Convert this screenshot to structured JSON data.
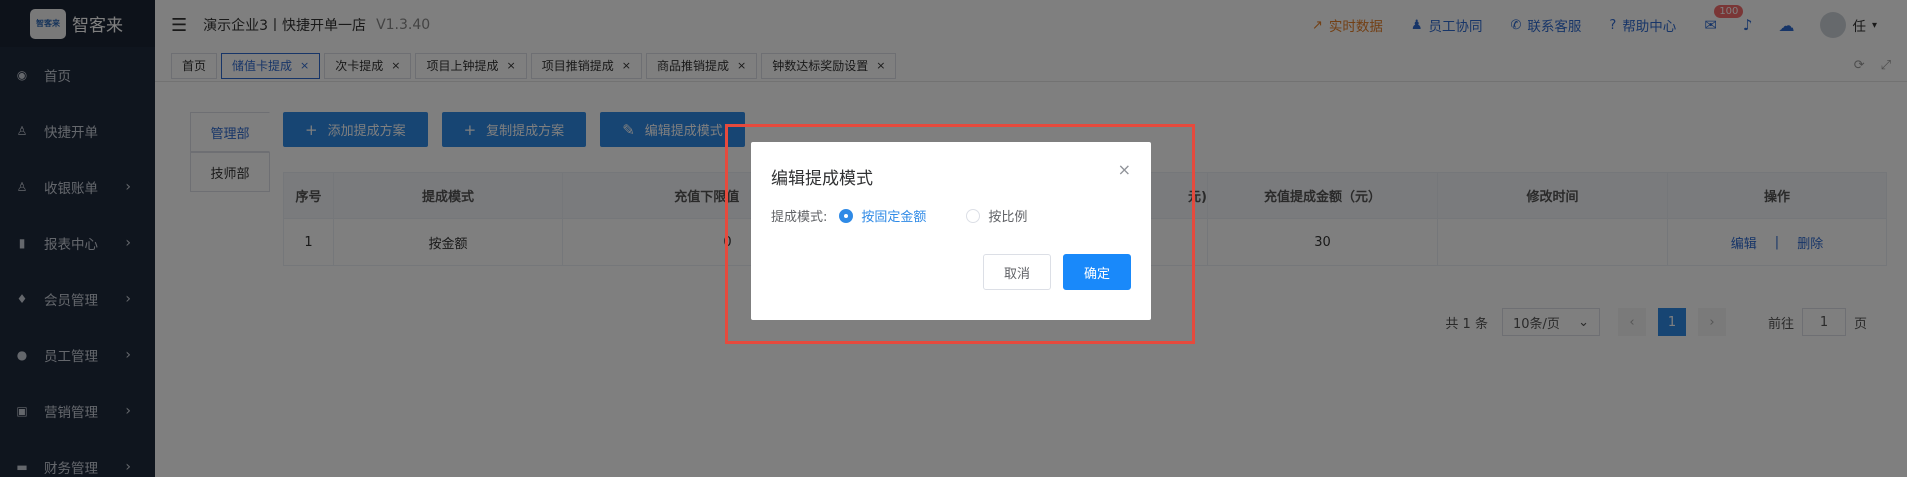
{
  "sidebar": {
    "logo_text": "智客来",
    "logo_mark": "智客来",
    "items": [
      {
        "label": "首页",
        "icon": "◉",
        "arrow": ""
      },
      {
        "label": "快捷开单",
        "icon": "♙",
        "arrow": ""
      },
      {
        "label": "收银账单",
        "icon": "♙",
        "arrow": "›"
      },
      {
        "label": "报表中心",
        "icon": "▮",
        "arrow": "›"
      },
      {
        "label": "会员管理",
        "icon": "♦",
        "arrow": "›"
      },
      {
        "label": "员工管理",
        "icon": "●",
        "arrow": "›"
      },
      {
        "label": "营销管理",
        "icon": "▣",
        "arrow": "›"
      },
      {
        "label": "财务管理",
        "icon": "▬",
        "arrow": "›"
      }
    ]
  },
  "header": {
    "menu_icon": "☰",
    "store_title": "演示企业3丨快捷开单一店",
    "version": "V1.3.40",
    "links": {
      "realtime": "实时数据",
      "staff_collab": "员工协同",
      "support": "联系客服",
      "help": "帮助中心"
    },
    "mail_badge": "100",
    "user_name": "任",
    "user_caret": "▾"
  },
  "tabs": [
    {
      "label": "首页",
      "closable": false
    },
    {
      "label": "储值卡提成",
      "closable": true
    },
    {
      "label": "次卡提成",
      "closable": true
    },
    {
      "label": "项目上钟提成",
      "closable": true
    },
    {
      "label": "项目推销提成",
      "closable": true
    },
    {
      "label": "商品推销提成",
      "closable": true
    },
    {
      "label": "钟数达标奖励设置",
      "closable": true
    }
  ],
  "depts": [
    "管理部",
    "技师部"
  ],
  "actions": {
    "add": "添加提成方案",
    "copy": "复制提成方案",
    "edit": "编辑提成模式"
  },
  "table": {
    "headers": [
      "序号",
      "提成模式",
      "充值下限值 （>）",
      "元)",
      "充值提成金额（元）",
      "修改时间",
      "操作"
    ],
    "rows": [
      {
        "index": "1",
        "mode": "按金额",
        "lower": "0",
        "amount": "30",
        "time": "",
        "edit": "编辑",
        "sep": "|",
        "delete": "删除"
      }
    ]
  },
  "pager": {
    "total": "共 1 条",
    "size": "10条/页",
    "prev": "‹",
    "current": "1",
    "next": "›",
    "goto_label": "前往",
    "goto_value": "1",
    "page_unit": "页"
  },
  "dialog": {
    "title": "编辑提成模式",
    "close": "×",
    "field_label": "提成模式:",
    "options": [
      "按固定金额",
      "按比例"
    ],
    "selected": "按固定金额",
    "cancel": "取消",
    "confirm": "确定"
  }
}
